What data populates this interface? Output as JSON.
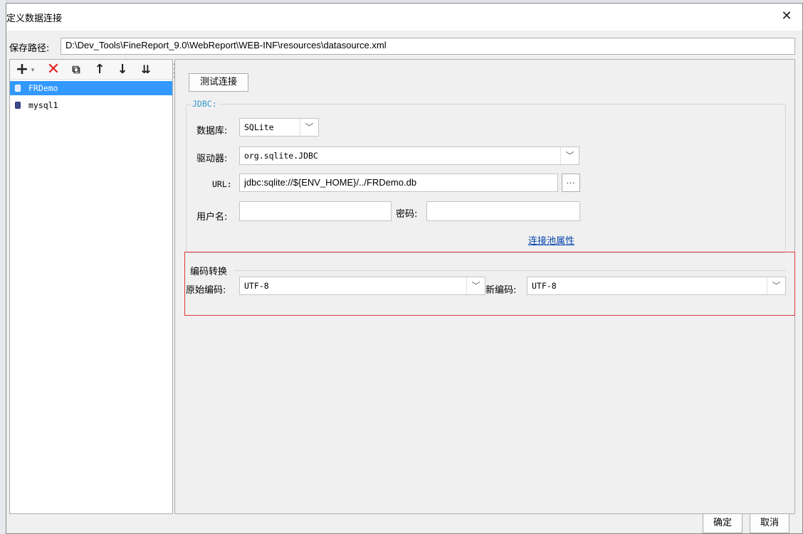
{
  "window": {
    "title": "定义数据连接",
    "close_glyph": "✕"
  },
  "path": {
    "label": "保存路径:",
    "value": "D:\\Dev_Tools\\FineReport_9.0\\WebReport\\WEB-INF\\resources\\datasource.xml"
  },
  "toolbar": {
    "add_glyph": "+",
    "add_dropdown_glyph": "▾",
    "delete_glyph": "✕",
    "copy_glyph": "⧉",
    "up_glyph": "↑",
    "down_glyph": "↓",
    "sort_glyph": "⇊"
  },
  "datasources": [
    {
      "name": "FRDemo",
      "selected": true
    },
    {
      "name": "mysql1",
      "selected": false
    }
  ],
  "form": {
    "test_button": "测试连接",
    "group_title": "JDBC:",
    "database_label": "数据库:",
    "database_value": "SQLite",
    "driver_label": "驱动器:",
    "driver_value": "org.sqlite.JDBC",
    "url_label": "URL:",
    "url_value": "jdbc:sqlite://${ENV_HOME}/../FRDemo.db",
    "url_browse": "...",
    "username_label": "用户名:",
    "username_value": "",
    "password_label": "密码:",
    "password_value": "",
    "pool_link": "连接池属性",
    "dropdown_arrow": "﹀"
  },
  "encoding": {
    "title": "编码转换",
    "original_label": "原始编码:",
    "original_value": "UTF-8",
    "new_label": "新编码:",
    "new_value": "UTF-8"
  },
  "footer": {
    "ok": "确定",
    "cancel": "取消"
  },
  "colors": {
    "selection": "#3399ff",
    "highlight_border": "#e03a3a",
    "link": "#0645ad",
    "delete_icon": "#e02020"
  }
}
